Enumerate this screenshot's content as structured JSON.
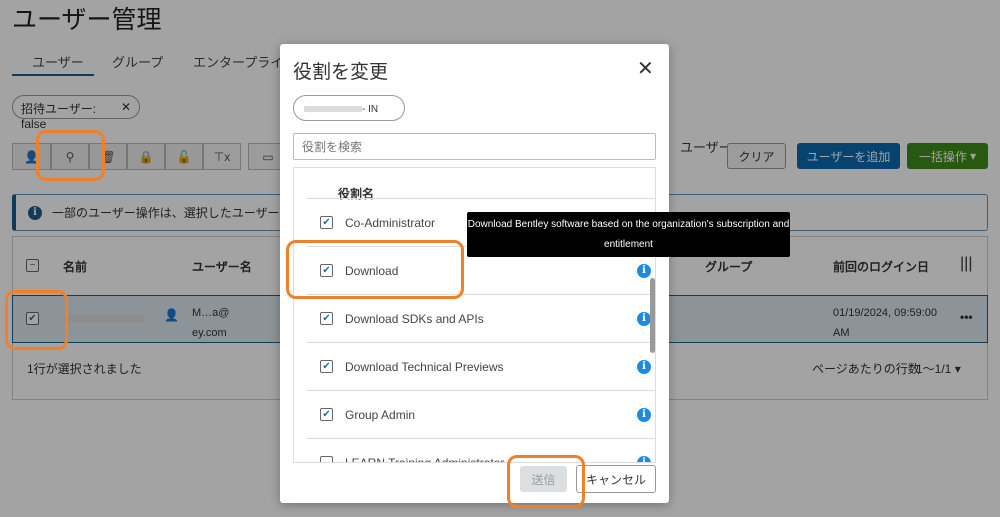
{
  "page": {
    "title": "ユーザー管理",
    "tabs": [
      "ユーザー",
      "グループ",
      "エンタープライズ"
    ],
    "filter_chip": "招待ユーザー: false",
    "user_filter_label": "ユーザー:",
    "clear": "クリア",
    "add_user": "ユーザーを追加",
    "bulk": "一括操作",
    "banner": "一部のユーザー操作は、選択したユーザーの役",
    "columns": {
      "name": "名前",
      "username": "ユーザー名",
      "group": "グループ",
      "last_login": "前回のログイン日"
    },
    "row": {
      "username_line1": "M…a@",
      "username_line2": "ey.com",
      "last_login": "01/19/2024, 09:59:00 AM"
    },
    "footer": {
      "selected": "1行が選択されました",
      "rows_per_page": "ページあたりの行数",
      "range": "1〜1/1"
    }
  },
  "modal": {
    "title": "役割を変更",
    "chip_suffix": "- IN",
    "search_placeholder": "役割を検索",
    "col": "役割名",
    "roles": [
      {
        "name": "Co-Administrator",
        "checked": true
      },
      {
        "name": "Download",
        "checked": true
      },
      {
        "name": "Download SDKs and APIs",
        "checked": true
      },
      {
        "name": "Download Technical Previews",
        "checked": true
      },
      {
        "name": "Group Admin",
        "checked": true
      },
      {
        "name": "LEARN Training Administrator",
        "checked": false
      }
    ],
    "submit": "送信",
    "cancel": "キャンセル",
    "tooltip": "Download Bentley software based on the organization's subscription and entitlement"
  }
}
